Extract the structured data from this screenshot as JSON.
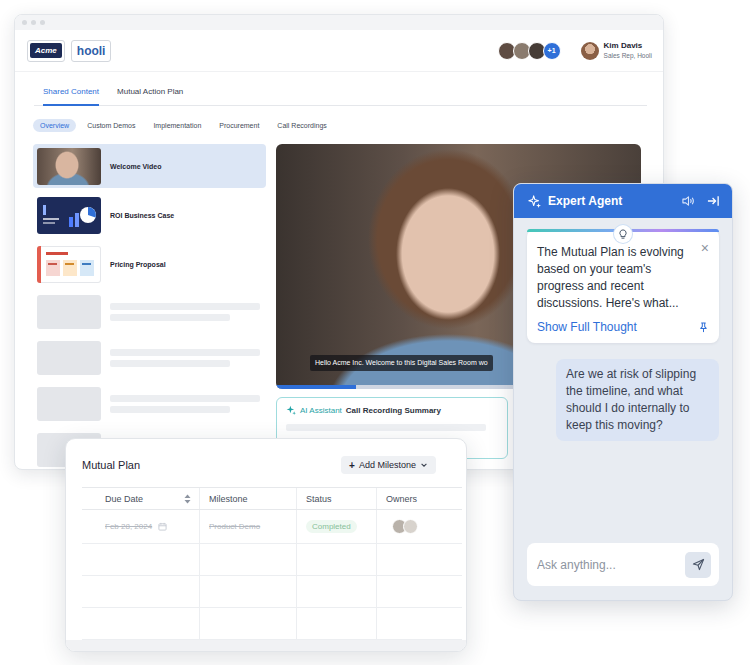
{
  "header": {
    "logos": [
      {
        "text": "Acme",
        "kind": "acme"
      },
      {
        "text": "hooli",
        "kind": "hooli"
      }
    ],
    "collaborators": [
      {
        "color": "#5e4c42"
      },
      {
        "color": "#8a7b6e"
      },
      {
        "color": "#463c36"
      }
    ],
    "more_collaborators": "+1",
    "user": {
      "name": "Kim Davis",
      "role": "Sales Rep, Hooli"
    }
  },
  "tabs": [
    {
      "label": "Shared Content",
      "selected": true
    },
    {
      "label": "Mutual Action Plan",
      "selected": false
    }
  ],
  "subtabs": [
    {
      "label": "Overview",
      "selected": true
    },
    {
      "label": "Custom Demos",
      "selected": false
    },
    {
      "label": "Implementation",
      "selected": false
    },
    {
      "label": "Procurement",
      "selected": false
    },
    {
      "label": "Call Recordings",
      "selected": false
    }
  ],
  "content_items": [
    {
      "title": "Welcome Video",
      "kind": "video",
      "selected": true
    },
    {
      "title": "ROI Business Case",
      "kind": "roi",
      "selected": false
    },
    {
      "title": "Pricing Proposal",
      "kind": "pricing",
      "selected": false
    },
    {
      "title": "",
      "kind": "placeholder",
      "selected": false
    },
    {
      "title": "",
      "kind": "placeholder",
      "selected": false
    },
    {
      "title": "",
      "kind": "placeholder",
      "selected": false
    },
    {
      "title": "",
      "kind": "placeholder",
      "selected": false
    }
  ],
  "video": {
    "caption": "Hello Acme Inc. Welcome to this Digital Sales Room wo",
    "progress": {
      "level": 0.22
    }
  },
  "summary": {
    "label": "AI Assistant",
    "title": "Call Recording Summary"
  },
  "mutual_plan": {
    "title": "Mutual Plan",
    "add_button": {
      "icon": "+",
      "label": "Add Milestone"
    },
    "columns": [
      {
        "label": "Due Date",
        "sortable": true
      },
      {
        "label": "Milestone",
        "sortable": false
      },
      {
        "label": "Status",
        "sortable": false
      },
      {
        "label": "Owners",
        "sortable": false
      }
    ],
    "rows": [
      {
        "kind": "entry",
        "due_date": "Feb 28, 2024",
        "milestone": "Product Demo",
        "status": "Completed",
        "completed": true,
        "owners": [
          {
            "color": "#b9b2aa"
          },
          {
            "color": "#d8d3cd"
          }
        ]
      },
      {
        "kind": "empty",
        "due_date": "",
        "milestone": "",
        "status": "",
        "completed": false,
        "owners": []
      },
      {
        "kind": "empty",
        "due_date": "",
        "milestone": "",
        "status": "",
        "completed": false,
        "owners": []
      },
      {
        "kind": "empty",
        "due_date": "",
        "milestone": "",
        "status": "",
        "completed": false,
        "owners": []
      }
    ]
  },
  "expert_agent": {
    "title": "Expert Agent",
    "thought": {
      "text": "The Mutual Plan is evolving based on your team's progress and recent discussions. Here's what...",
      "link": "Show Full Thought",
      "close": "×"
    },
    "messages": [
      {
        "role": "user",
        "text": "Are we at risk of slipping the timeline, and what should I do internally to keep this moving?"
      }
    ],
    "input": {
      "placeholder": "Ask anything..."
    }
  }
}
